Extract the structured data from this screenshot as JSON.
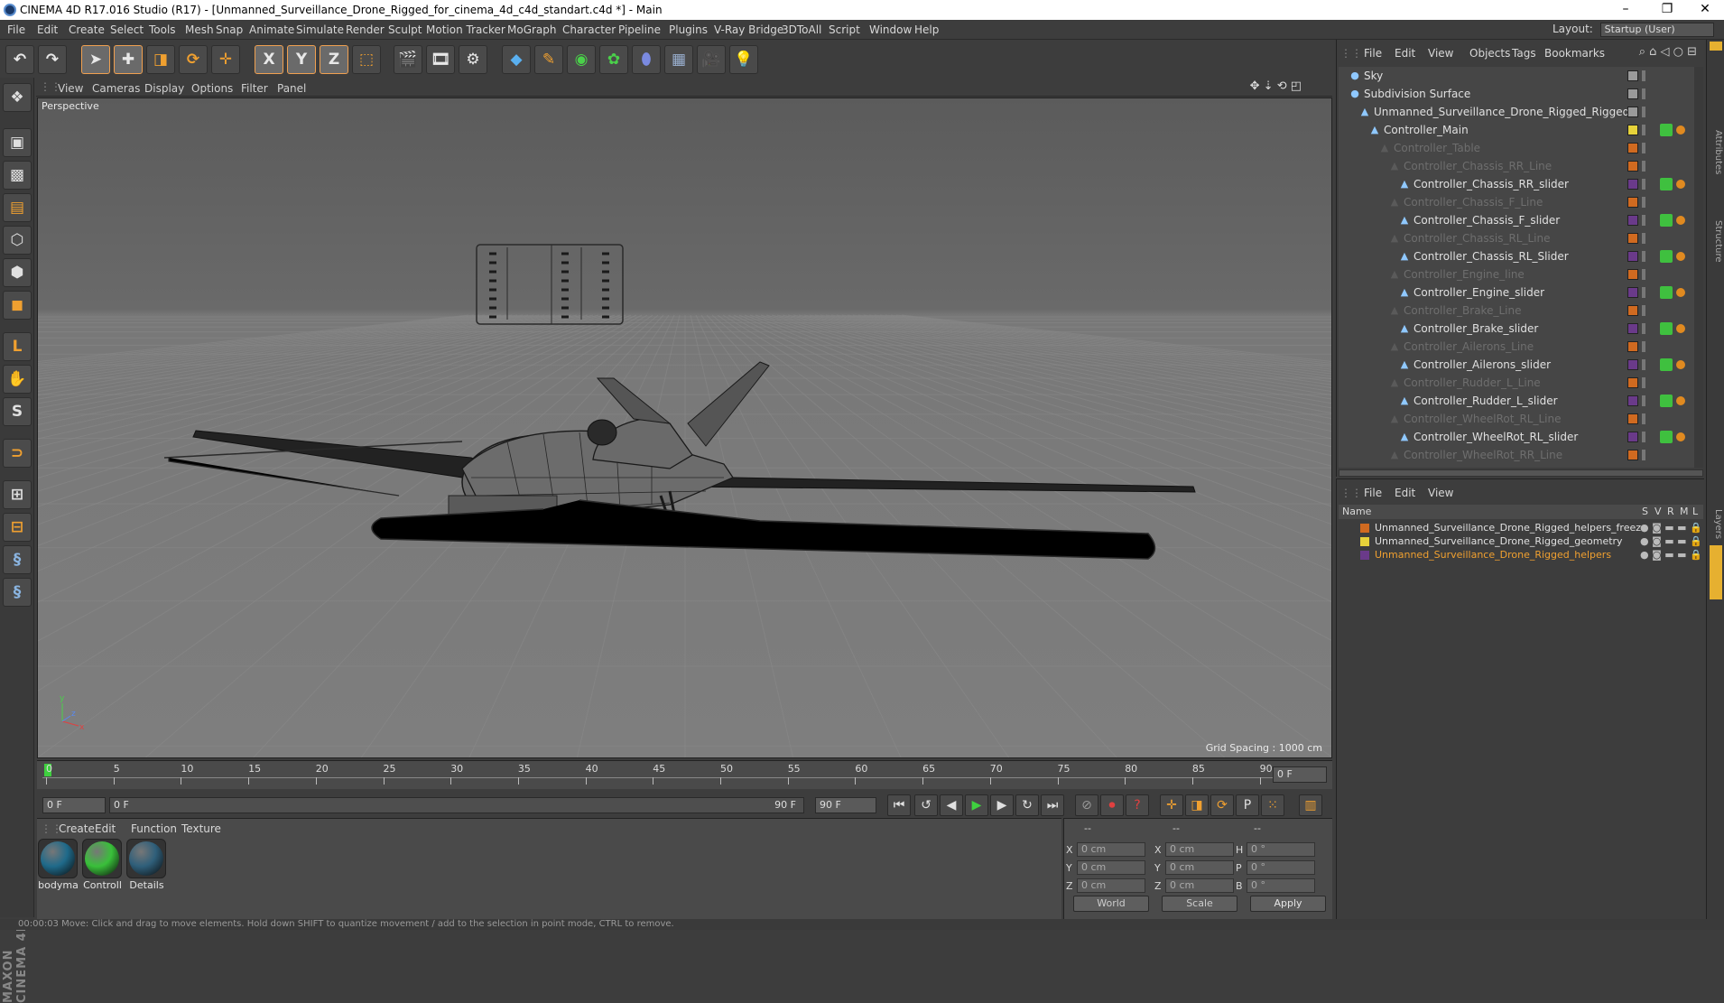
{
  "window": {
    "title": "CINEMA 4D R17.016 Studio (R17) - [Unmanned_Surveillance_Drone_Rigged_for_cinema_4d_c4d_standart.c4d *] - Main"
  },
  "menu": [
    "File",
    "Edit",
    "Create",
    "Select",
    "Tools",
    "Mesh",
    "Snap",
    "Animate",
    "Simulate",
    "Render",
    "Sculpt",
    "Motion Tracker",
    "MoGraph",
    "Character",
    "Pipeline",
    "Plugins",
    "V-Ray Bridge",
    "3DToAll",
    "Script",
    "Window",
    "Help"
  ],
  "layout": {
    "label": "Layout:",
    "value": "Startup (User)"
  },
  "toolbar": {
    "x": "X",
    "y": "Y",
    "z": "Z"
  },
  "viewport": {
    "menu": [
      "View",
      "Cameras",
      "Display",
      "Options",
      "Filter",
      "Panel"
    ],
    "label": "Perspective",
    "grid_spacing": "Grid Spacing : 1000 cm"
  },
  "timeline": {
    "ticks": [
      "0",
      "5",
      "10",
      "15",
      "20",
      "25",
      "30",
      "35",
      "40",
      "45",
      "50",
      "55",
      "60",
      "65",
      "70",
      "75",
      "80",
      "85",
      "90"
    ],
    "current_frame": "0 F",
    "start": "0 F",
    "range_start": "0 F",
    "range_end": "90 F",
    "end": "90 F"
  },
  "materials": {
    "menu": [
      "Create",
      "Edit",
      "Function",
      "Texture"
    ],
    "items": [
      {
        "name": "bodyma",
        "color": "#1f6a8a"
      },
      {
        "name": "Controll",
        "color": "#39c03a"
      },
      {
        "name": "Details",
        "color": "#2f5f7a"
      }
    ]
  },
  "coords": {
    "headers": [
      "--",
      "--",
      "--"
    ],
    "rows": [
      {
        "a": "X",
        "av": "0 cm",
        "b": "X",
        "bv": "0 cm",
        "c": "H",
        "cv": "0 °"
      },
      {
        "a": "Y",
        "av": "0 cm",
        "b": "Y",
        "bv": "0 cm",
        "c": "P",
        "cv": "0 °"
      },
      {
        "a": "Z",
        "av": "0 cm",
        "b": "Z",
        "bv": "0 cm",
        "c": "B",
        "cv": "0 °"
      }
    ],
    "mode1": "World",
    "mode2": "Scale",
    "apply": "Apply"
  },
  "objects": {
    "menu": [
      "File",
      "Edit",
      "View",
      "Objects",
      "Tags",
      "Bookmarks"
    ],
    "items": [
      {
        "name": "Sky",
        "indent": 0,
        "dim": false,
        "color": "#9a9a9a"
      },
      {
        "name": "Subdivision Surface",
        "indent": 0,
        "dim": false,
        "color": "#9a9a9a"
      },
      {
        "name": "Unmanned_Surveillance_Drone_Rigged_Rigged",
        "indent": 1,
        "dim": false,
        "color": "#9a9a9a"
      },
      {
        "name": "Controller_Main",
        "indent": 2,
        "dim": false,
        "color": "#e6d23a"
      },
      {
        "name": "Controller_Table",
        "indent": 3,
        "dim": true,
        "color": "#d06a20"
      },
      {
        "name": "Controller_Chassis_RR_Line",
        "indent": 4,
        "dim": true,
        "color": "#d06a20"
      },
      {
        "name": "Controller_Chassis_RR_slider",
        "indent": 5,
        "dim": false,
        "color": "#6a3a8a"
      },
      {
        "name": "Controller_Chassis_F_Line",
        "indent": 4,
        "dim": true,
        "color": "#d06a20"
      },
      {
        "name": "Controller_Chassis_F_slider",
        "indent": 5,
        "dim": false,
        "color": "#6a3a8a"
      },
      {
        "name": "Controller_Chassis_RL_Line",
        "indent": 4,
        "dim": true,
        "color": "#d06a20"
      },
      {
        "name": "Controller_Chassis_RL_Slider",
        "indent": 5,
        "dim": false,
        "color": "#6a3a8a"
      },
      {
        "name": "Controller_Engine_line",
        "indent": 4,
        "dim": true,
        "color": "#d06a20"
      },
      {
        "name": "Controller_Engine_slider",
        "indent": 5,
        "dim": false,
        "color": "#6a3a8a"
      },
      {
        "name": "Controller_Brake_Line",
        "indent": 4,
        "dim": true,
        "color": "#d06a20"
      },
      {
        "name": "Controller_Brake_slider",
        "indent": 5,
        "dim": false,
        "color": "#6a3a8a"
      },
      {
        "name": "Controller_Ailerons_Line",
        "indent": 4,
        "dim": true,
        "color": "#d06a20"
      },
      {
        "name": "Controller_Ailerons_slider",
        "indent": 5,
        "dim": false,
        "color": "#6a3a8a"
      },
      {
        "name": "Controller_Rudder_L_Line",
        "indent": 4,
        "dim": true,
        "color": "#d06a20"
      },
      {
        "name": "Controller_Rudder_L_slider",
        "indent": 5,
        "dim": false,
        "color": "#6a3a8a"
      },
      {
        "name": "Controller_WheelRot_RL_Line",
        "indent": 4,
        "dim": true,
        "color": "#d06a20"
      },
      {
        "name": "Controller_WheelRot_RL_slider",
        "indent": 5,
        "dim": false,
        "color": "#6a3a8a"
      },
      {
        "name": "Controller_WheelRot_RR_Line",
        "indent": 4,
        "dim": true,
        "color": "#d06a20"
      }
    ]
  },
  "layers": {
    "menu": [
      "File",
      "Edit",
      "View"
    ],
    "headers": {
      "name": "Name",
      "s": "S",
      "v": "V",
      "r": "R",
      "m": "M",
      "l": "L"
    },
    "items": [
      {
        "name": "Unmanned_Surveillance_Drone_Rigged_helpers_freez",
        "color": "#d06a20",
        "highlight": false
      },
      {
        "name": "Unmanned_Surveillance_Drone_Rigged_geometry",
        "color": "#e6d23a",
        "highlight": false
      },
      {
        "name": "Unmanned_Surveillance_Drone_Rigged_helpers",
        "color": "#6a3a8a",
        "highlight": true
      }
    ]
  },
  "status": {
    "text": "00:00:03   Move: Click and drag to move elements. Hold down SHIFT to quantize movement / add to the selection in point mode, CTRL to remove."
  }
}
